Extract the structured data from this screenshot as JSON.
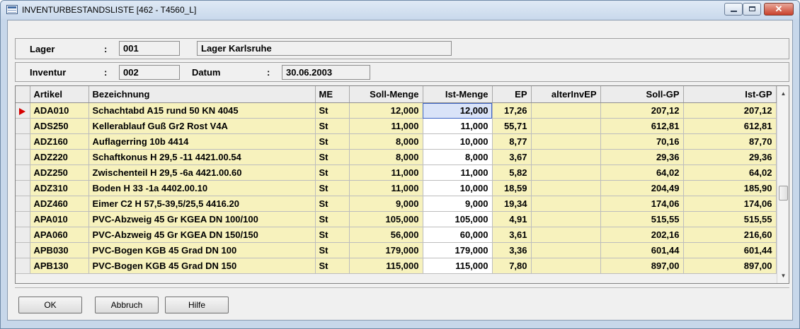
{
  "window": {
    "title": "INVENTURBESTANDSLISTE  [462 - T4560_L]"
  },
  "lager": {
    "label": "Lager",
    "sep": ":",
    "code": "001",
    "name": "Lager Karlsruhe"
  },
  "inventur": {
    "label": "Inventur",
    "sep": ":",
    "code": "002",
    "datum_label": "Datum",
    "datum_sep": ":",
    "datum": "30.06.2003"
  },
  "grid": {
    "columns": [
      "Artikel",
      "Bezeichnung",
      "ME",
      "Soll-Menge",
      "Ist-Menge",
      "EP",
      "alterInvEP",
      "Soll-GP",
      "Ist-GP"
    ],
    "selected_row": 0,
    "rows": [
      [
        "ADA010",
        "Schachtabd A15 rund 50 KN 4045",
        "St",
        "12,000",
        "12,000",
        "17,26",
        "",
        "207,12",
        "207,12"
      ],
      [
        "ADS250",
        "Kellerablauf Guß Gr2 Rost V4A",
        "St",
        "11,000",
        "11,000",
        "55,71",
        "",
        "612,81",
        "612,81"
      ],
      [
        "ADZ160",
        "Auflagerring 10b  4414",
        "St",
        "8,000",
        "10,000",
        "8,77",
        "",
        "70,16",
        "87,70"
      ],
      [
        "ADZ220",
        "Schaftkonus H 29,5 -11 4421.00.54",
        "St",
        "8,000",
        "8,000",
        "3,67",
        "",
        "29,36",
        "29,36"
      ],
      [
        "ADZ250",
        "Zwischenteil H 29,5 -6a 4421.00.60",
        "St",
        "11,000",
        "11,000",
        "5,82",
        "",
        "64,02",
        "64,02"
      ],
      [
        "ADZ310",
        "Boden H 33 -1a 4402.00.10",
        "St",
        "11,000",
        "10,000",
        "18,59",
        "",
        "204,49",
        "185,90"
      ],
      [
        "ADZ460",
        "Eimer C2 H 57,5-39,5/25,5 4416.20",
        "St",
        "9,000",
        "9,000",
        "19,34",
        "",
        "174,06",
        "174,06"
      ],
      [
        "APA010",
        "PVC-Abzweig 45 Gr KGEA DN 100/100",
        "St",
        "105,000",
        "105,000",
        "4,91",
        "",
        "515,55",
        "515,55"
      ],
      [
        "APA060",
        "PVC-Abzweig 45 Gr KGEA DN 150/150",
        "St",
        "56,000",
        "60,000",
        "3,61",
        "",
        "202,16",
        "216,60"
      ],
      [
        "APB030",
        "PVC-Bogen KGB 45 Grad DN 100",
        "St",
        "179,000",
        "179,000",
        "3,36",
        "",
        "601,44",
        "601,44"
      ],
      [
        "APB130",
        "PVC-Bogen KGB 45 Grad DN 150",
        "St",
        "115,000",
        "115,000",
        "7,80",
        "",
        "897,00",
        "897,00"
      ]
    ]
  },
  "buttons": {
    "ok": "OK",
    "abbruch": "Abbruch",
    "hilfe": "Hilfe"
  },
  "scroll": {
    "up_glyph": "▲",
    "down_glyph": "▼"
  },
  "window_buttons": {
    "close_glyph": "✕"
  }
}
